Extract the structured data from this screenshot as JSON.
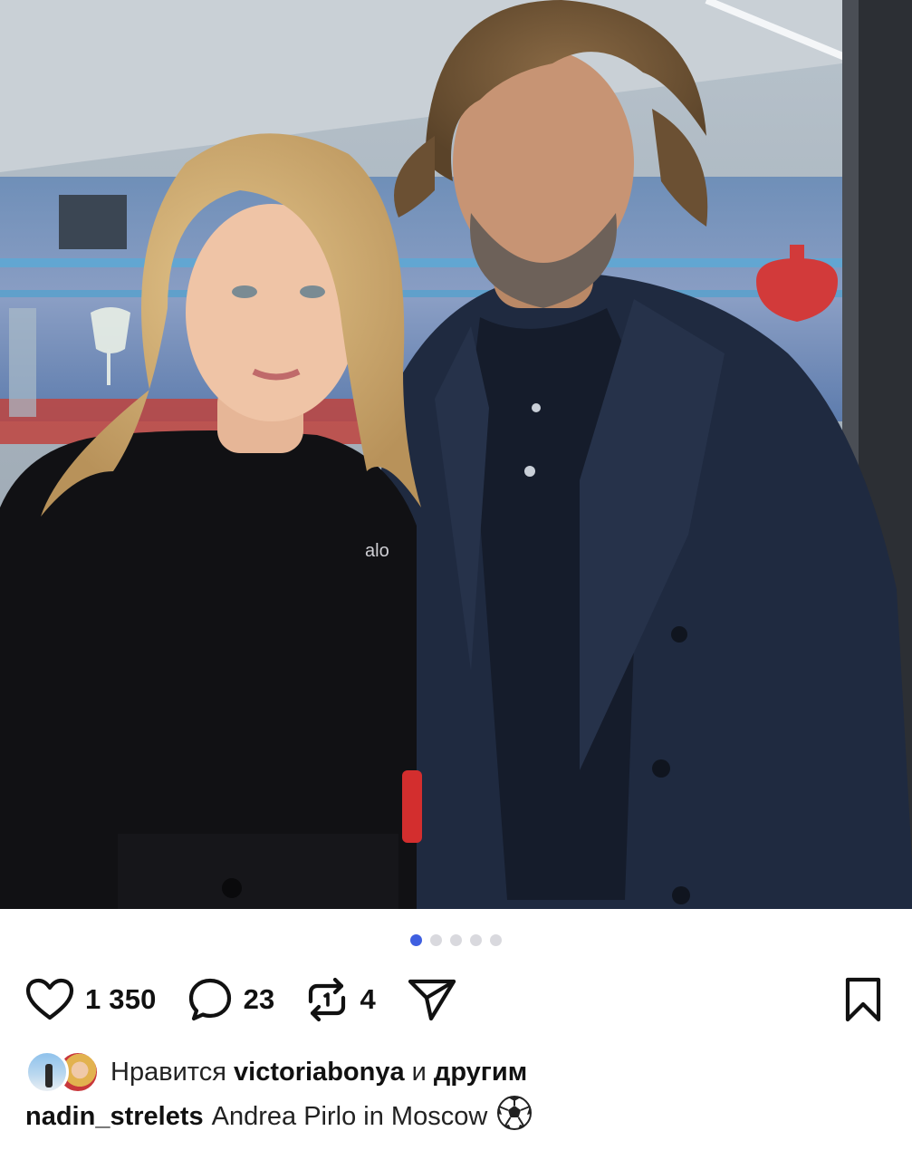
{
  "post": {
    "photo_alt": "Andrea Pirlo in Moscow",
    "carousel": {
      "total": 5,
      "active_index": 0
    },
    "actions": {
      "likes_count": "1 350",
      "comments_count": "23",
      "reposts_count": "4"
    },
    "liked_by": {
      "prefix": "Нравится",
      "user": "victoriabonya",
      "joiner": "и",
      "others": "другим"
    },
    "caption": {
      "author": "nadin_strelets",
      "text": "Andrea Pirlo in Moscow",
      "emoji": "⚽"
    },
    "icons": {
      "like": "heart-icon",
      "comment": "comment-bubble-icon",
      "repost": "repost-icon",
      "share": "send-icon",
      "save": "bookmark-icon"
    },
    "colors": {
      "active_dot": "#3f5fe0",
      "inactive_dot": "#d9d9de"
    }
  }
}
